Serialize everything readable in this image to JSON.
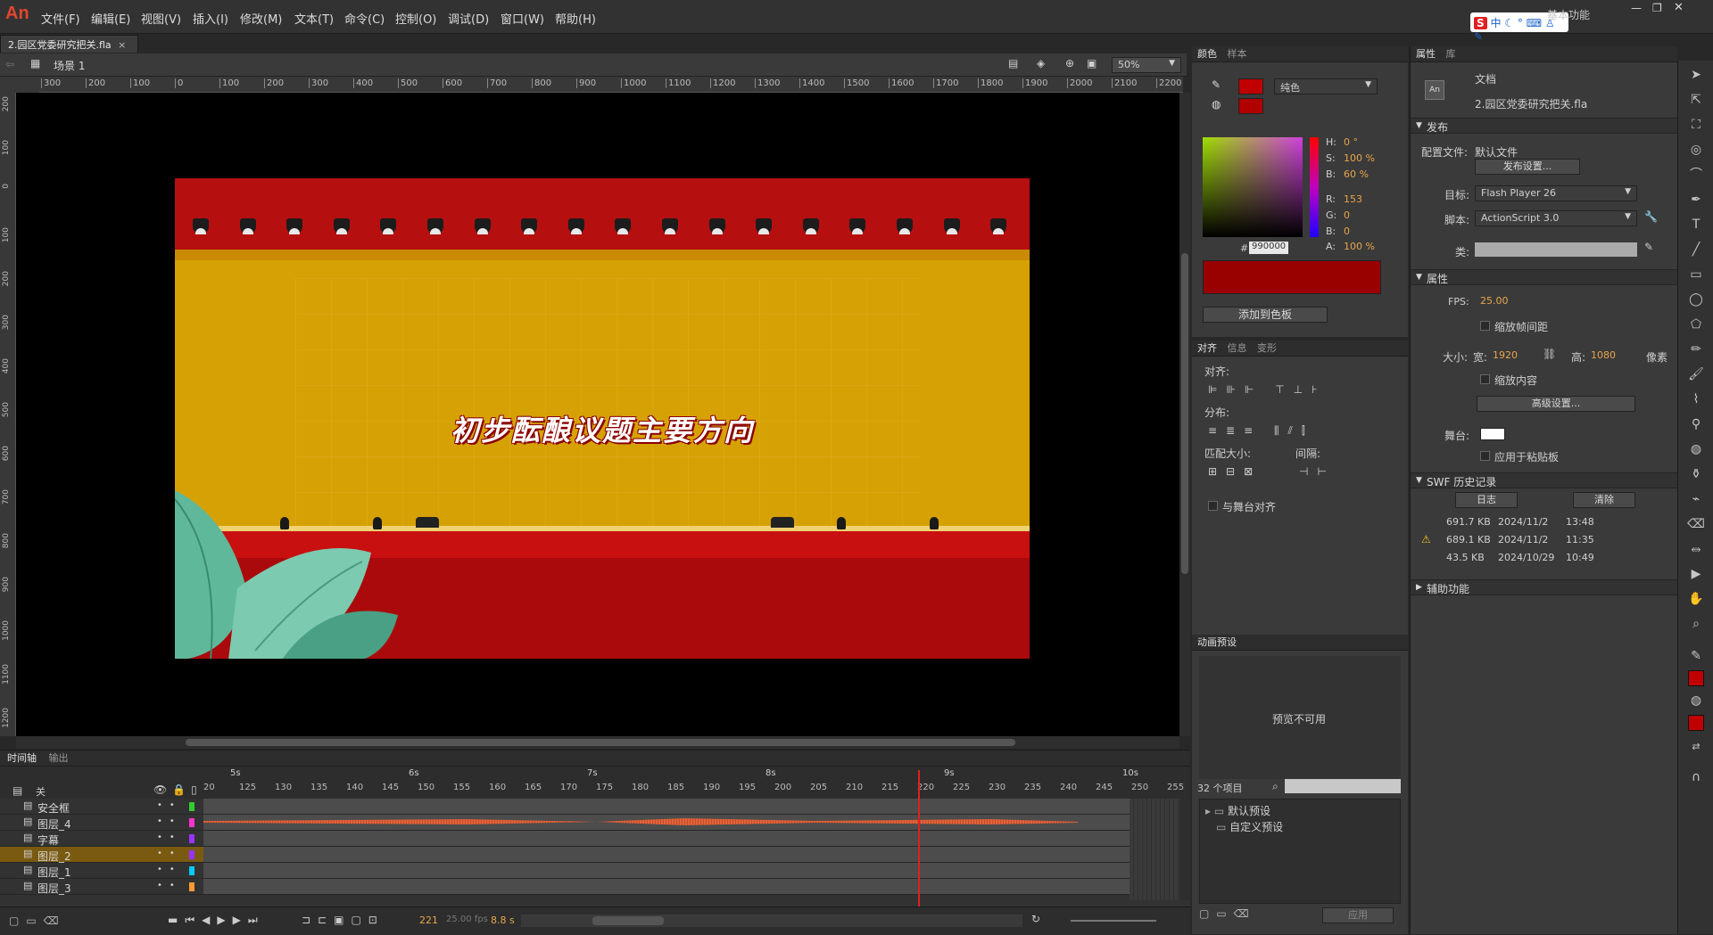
{
  "app": {
    "logo": "An",
    "workspace": "基本功能"
  },
  "menu": [
    "文件(F)",
    "编辑(E)",
    "视图(V)",
    "插入(I)",
    "修改(M)",
    "文本(T)",
    "命令(C)",
    "控制(O)",
    "调试(D)",
    "窗口(W)",
    "帮助(H)"
  ],
  "document": {
    "tab_title": "2.园区党委研究把关.fla",
    "scene": "场景 1",
    "zoom": "50%"
  },
  "ruler_h": [
    "300",
    "200",
    "100",
    "0",
    "100",
    "200",
    "300",
    "400",
    "500",
    "600",
    "700",
    "800",
    "900",
    "1000",
    "1100",
    "1200",
    "1300",
    "1400",
    "1500",
    "1600",
    "1700",
    "1800",
    "1900",
    "2000",
    "2100",
    "2200"
  ],
  "ruler_v": [
    "200",
    "100",
    "0",
    "100",
    "200",
    "300",
    "400",
    "500",
    "600",
    "700",
    "800",
    "900",
    "1000",
    "1100",
    "1200"
  ],
  "stage": {
    "title_text": "初步酝酿议题主要方向"
  },
  "ime": {
    "label": "中"
  },
  "color_panel": {
    "tabs": [
      "颜色",
      "样本"
    ],
    "fill_type": "纯色",
    "h_label": "H:",
    "h": "0",
    "h_unit": "°",
    "s_label": "S:",
    "s": "100",
    "s_unit": "%",
    "b_label": "B:",
    "b": "60",
    "b_unit": "%",
    "r_label": "R:",
    "r": "153",
    "g_label": "G:",
    "g": "0",
    "bb_label": "B:",
    "bv": "0",
    "a_label": "A:",
    "a": "100",
    "a_unit": "%",
    "hash": "#",
    "hex": "990000",
    "add_button": "添加到色板",
    "swatch_color": "#990000"
  },
  "align_panel": {
    "tabs": [
      "对齐",
      "信息",
      "变形"
    ],
    "align_label": "对齐:",
    "distribute_label": "分布:",
    "match_label": "匹配大小:",
    "space_label": "间隔:",
    "stage_align": "与舞台对齐"
  },
  "motion_presets": {
    "title": "动画预设",
    "preview": "预览不可用",
    "count": "32 个项目",
    "folders": [
      "默认预设",
      "自定义预设"
    ],
    "apply": "应用"
  },
  "properties": {
    "tabs": [
      "属性",
      "库"
    ],
    "doc_label": "文档",
    "doc_name": "2.园区党委研究把关.fla",
    "publish_section": "发布",
    "profile_label": "配置文件:",
    "profile_value": "默认文件",
    "publish_settings": "发布设置...",
    "target_label": "目标:",
    "target_value": "Flash Player 26",
    "script_label": "脚本:",
    "script_value": "ActionScript 3.0",
    "class_label": "类:",
    "props_section": "属性",
    "fps_label": "FPS:",
    "fps": "25.00",
    "scale_span": "缩放帧间距",
    "size_label": "大小:",
    "width_label": "宽:",
    "width": "1920",
    "height_label": "高:",
    "height": "1080",
    "px": "像素",
    "scale_content": "缩放内容",
    "advanced": "高级设置...",
    "stage_label": "舞台:",
    "apply_paste": "应用于粘贴板",
    "swf_section": "SWF 历史记录",
    "log_button": "日志",
    "clear_button": "清除",
    "history": [
      {
        "size": "691.7 KB",
        "date": "2024/11/2",
        "time": "13:48",
        "warn": false
      },
      {
        "size": "689.1 KB",
        "date": "2024/11/2",
        "time": "11:35",
        "warn": true
      },
      {
        "size": "43.5 KB",
        "date": "2024/10/29",
        "time": "10:49",
        "warn": false
      }
    ],
    "accessibility_section": "辅助功能"
  },
  "timeline": {
    "tabs": [
      "时间轴",
      "输出"
    ],
    "off_label": "关",
    "seconds": [
      "5s",
      "6s",
      "7s",
      "8s",
      "9s",
      "10s"
    ],
    "frame_numbers": [
      "20",
      "125",
      "130",
      "135",
      "140",
      "145",
      "150",
      "155",
      "160",
      "165",
      "170",
      "175",
      "180",
      "185",
      "190",
      "195",
      "200",
      "205",
      "210",
      "215",
      "220",
      "225",
      "230",
      "235",
      "240",
      "245",
      "250",
      "255"
    ],
    "layers": [
      {
        "name": "安全框",
        "color": "#33cc33"
      },
      {
        "name": "图层_4",
        "color": "#ff33cc"
      },
      {
        "name": "字幕",
        "color": "#9933ff"
      },
      {
        "name": "图层_2",
        "color": "#9933ff",
        "selected": true
      },
      {
        "name": "图层_1",
        "color": "#00ccff"
      },
      {
        "name": "图层_3",
        "color": "#ff9933"
      }
    ],
    "current_frame": "221",
    "fps_text": "25.00 fps",
    "time_text": "8.8 s"
  }
}
